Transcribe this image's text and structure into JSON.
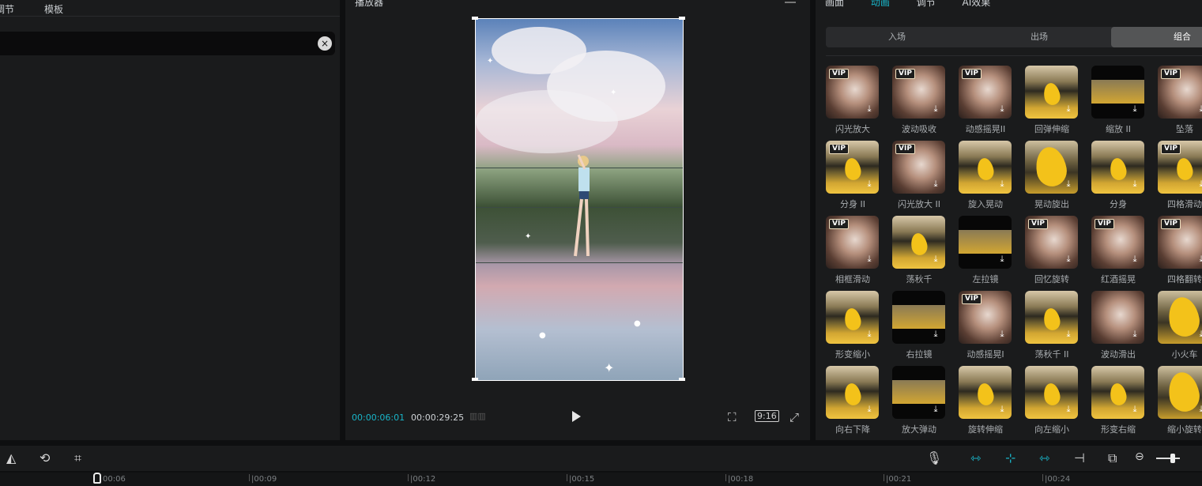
{
  "left_panel": {
    "tabs": [
      "调节",
      "模板"
    ],
    "clear_icon": "×"
  },
  "player": {
    "title": "播放器",
    "current_time": "00:00:06:01",
    "total_time": "00:00:29:25",
    "ratio": "9:16"
  },
  "right_panel": {
    "tabs": [
      "画面",
      "动画",
      "调节",
      "AI效果"
    ],
    "active_tab": "动画",
    "segments": [
      "入场",
      "出场",
      "组合"
    ],
    "active_segment": "组合",
    "items": [
      {
        "label": "闪光放大",
        "vip": true,
        "style": "blurry"
      },
      {
        "label": "波动吸收",
        "vip": true,
        "style": "blurry"
      },
      {
        "label": "动感摇晃II",
        "vip": true,
        "style": "blurry"
      },
      {
        "label": "回弹伸缩",
        "vip": false,
        "style": "forest"
      },
      {
        "label": "缩放 II",
        "vip": false,
        "style": "dark"
      },
      {
        "label": "坠落",
        "vip": true,
        "style": "blurry"
      },
      {
        "label": "分身 II",
        "vip": true,
        "style": "forest"
      },
      {
        "label": "闪光放大 II",
        "vip": true,
        "style": "blurry"
      },
      {
        "label": "旋入晃动",
        "vip": false,
        "style": "forest"
      },
      {
        "label": "晃动旋出",
        "vip": false,
        "style": "leafbig"
      },
      {
        "label": "分身",
        "vip": false,
        "style": "forest"
      },
      {
        "label": "四格滑动",
        "vip": true,
        "style": "forest"
      },
      {
        "label": "相框滑动",
        "vip": true,
        "style": "blurry"
      },
      {
        "label": "荡秋千",
        "vip": false,
        "style": "forest"
      },
      {
        "label": "左拉镜",
        "vip": false,
        "style": "dark"
      },
      {
        "label": "回忆旋转",
        "vip": true,
        "style": "blurry"
      },
      {
        "label": "红酒摇晃",
        "vip": true,
        "style": "blurry"
      },
      {
        "label": "四格翻转",
        "vip": true,
        "style": "blurry"
      },
      {
        "label": "形变缩小",
        "vip": false,
        "style": "forest"
      },
      {
        "label": "右拉镜",
        "vip": false,
        "style": "dark"
      },
      {
        "label": "动感摇晃I",
        "vip": true,
        "style": "blurry"
      },
      {
        "label": "荡秋千 II",
        "vip": false,
        "style": "forest"
      },
      {
        "label": "波动滑出",
        "vip": false,
        "style": "blurry"
      },
      {
        "label": "小火车",
        "vip": false,
        "style": "leafbig"
      },
      {
        "label": "向右下降",
        "vip": false,
        "style": "forest"
      },
      {
        "label": "放大弹动",
        "vip": false,
        "style": "dark"
      },
      {
        "label": "旋转伸缩",
        "vip": false,
        "style": "forest"
      },
      {
        "label": "向左缩小",
        "vip": false,
        "style": "forest"
      },
      {
        "label": "形变右缩",
        "vip": false,
        "style": "forest"
      },
      {
        "label": "缩小旋转",
        "vip": false,
        "style": "leafbig"
      }
    ]
  },
  "timeline": {
    "ruler_ticks": [
      "00:06",
      "|00:09",
      "|00:12",
      "|00:15",
      "|00:18",
      "|00:21",
      "|00:24"
    ]
  },
  "colors": {
    "accent": "#19b5c9",
    "panel": "#1a1b1c"
  }
}
